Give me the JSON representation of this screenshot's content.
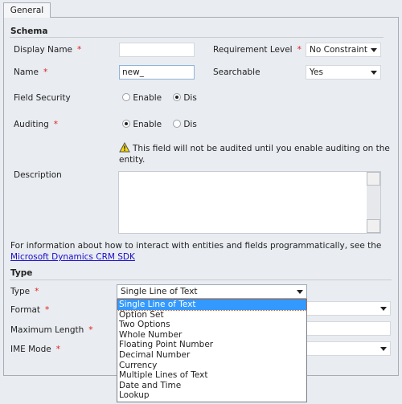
{
  "tab": "General",
  "schema": {
    "heading": "Schema",
    "display_name": {
      "label": "Display Name",
      "value": ""
    },
    "requirement_level": {
      "label": "Requirement Level",
      "value": "No Constraint"
    },
    "name": {
      "label": "Name",
      "value": "new_"
    },
    "searchable": {
      "label": "Searchable",
      "value": "Yes"
    },
    "field_security": {
      "label": "Field Security",
      "options": [
        "Enable",
        "Dis"
      ],
      "selected": "Dis"
    },
    "auditing": {
      "label": "Auditing",
      "options": [
        "Enable",
        "Dis"
      ],
      "selected": "Enable"
    },
    "warning": {
      "icon": "warning-icon",
      "line1": "This field will not be audited until you enable auditing on the",
      "line2": "entity."
    },
    "description": {
      "label": "Description",
      "value": ""
    },
    "info_text": "For information about how to interact with entities and fields programmatically, see the",
    "sdk_link": "Microsoft Dynamics CRM SDK"
  },
  "type_section": {
    "heading": "Type",
    "type": {
      "label": "Type",
      "value": "Single Line of Text"
    },
    "format": {
      "label": "Format"
    },
    "max_length": {
      "label": "Maximum Length"
    },
    "ime_mode": {
      "label": "IME Mode"
    },
    "dropdown_options": [
      "Single Line of Text",
      "Option Set",
      "Two Options",
      "Whole Number",
      "Floating Point Number",
      "Decimal Number",
      "Currency",
      "Multiple Lines of Text",
      "Date and Time",
      "Lookup"
    ],
    "highlighted": "Single Line of Text"
  },
  "required_marker": "*",
  "colors": {
    "highlight": "#3399ff",
    "required": "#e0201c",
    "link": "#1a0dcc"
  }
}
